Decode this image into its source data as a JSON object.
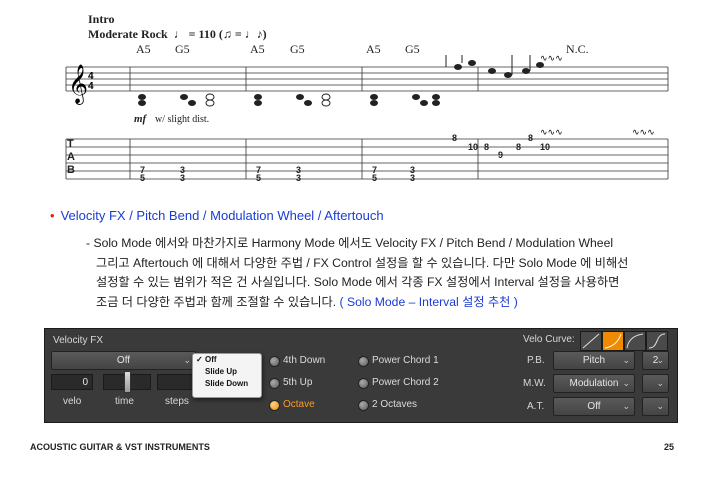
{
  "notation": {
    "section": "Intro",
    "tempo": "Moderate Rock",
    "bpm": "= 110",
    "chords": [
      "A5",
      "G5",
      "A5",
      "G5",
      "A5",
      "G5",
      "N.C."
    ],
    "dynamic": "mf",
    "dynamic_note": "w/ slight dist.",
    "tab_strings": [
      "T",
      "A",
      "B"
    ],
    "tab_numbers": [
      "7",
      "5",
      "3",
      "3",
      "7",
      "5",
      "3",
      "3",
      "7",
      "5",
      "3",
      "3",
      "8",
      "10",
      "8",
      "9",
      "8",
      "8",
      "10"
    ]
  },
  "bullet": {
    "text": "Velocity FX / Pitch Bend / Modulation Wheel / Aftertouch"
  },
  "paragraph": {
    "lines": [
      "- Solo Mode 에서와 마찬가지로 Harmony Mode 에서도 Velocity FX / Pitch Bend / Modulation Wheel",
      "그리고 Aftertouch 에 대해서 다양한 주법 / FX Control 설정을 할 수 있습니다. 다만 Solo Mode 에 비해선",
      "설정할 수 있는 범위가 적은 건 사실입니다. Solo Mode 에서 각종 FX 설정에서 Interval 설정을 사용하면",
      "조금 더 다양한 주법과 함께 조절할 수 있습니다."
    ],
    "link": "( Solo Mode – Interval 설정 추천 )"
  },
  "panel": {
    "title": "Velocity FX",
    "fx_select": "Off",
    "velo_value": "0",
    "labels": {
      "velo": "velo",
      "time": "time",
      "steps": "steps"
    },
    "popup_options": [
      {
        "label": "Off",
        "checked": true
      },
      {
        "label": "Slide Up",
        "checked": false
      },
      {
        "label": "Slide Down",
        "checked": false
      }
    ],
    "radios_col1": [
      {
        "label": "4th Down",
        "on": false
      },
      {
        "label": "5th Up",
        "on": false
      },
      {
        "label": "Octave",
        "on": true
      }
    ],
    "radios_col2": [
      {
        "label": "Power Chord 1",
        "on": false
      },
      {
        "label": "Power Chord 2",
        "on": false
      },
      {
        "label": "2 Octaves",
        "on": false
      }
    ],
    "velo_curve_label": "Velo Curve:",
    "pb": {
      "label": "P.B.",
      "value": "Pitch",
      "amount": "2"
    },
    "mw": {
      "label": "M.W.",
      "value": "Modulation",
      "amount": ""
    },
    "at": {
      "label": "A.T.",
      "value": "Off",
      "amount": ""
    },
    "accent_color": "#f08a00"
  },
  "footer": {
    "left": "ACOUSTIC GUITAR & VST INSTRUMENTS",
    "page": "25"
  }
}
